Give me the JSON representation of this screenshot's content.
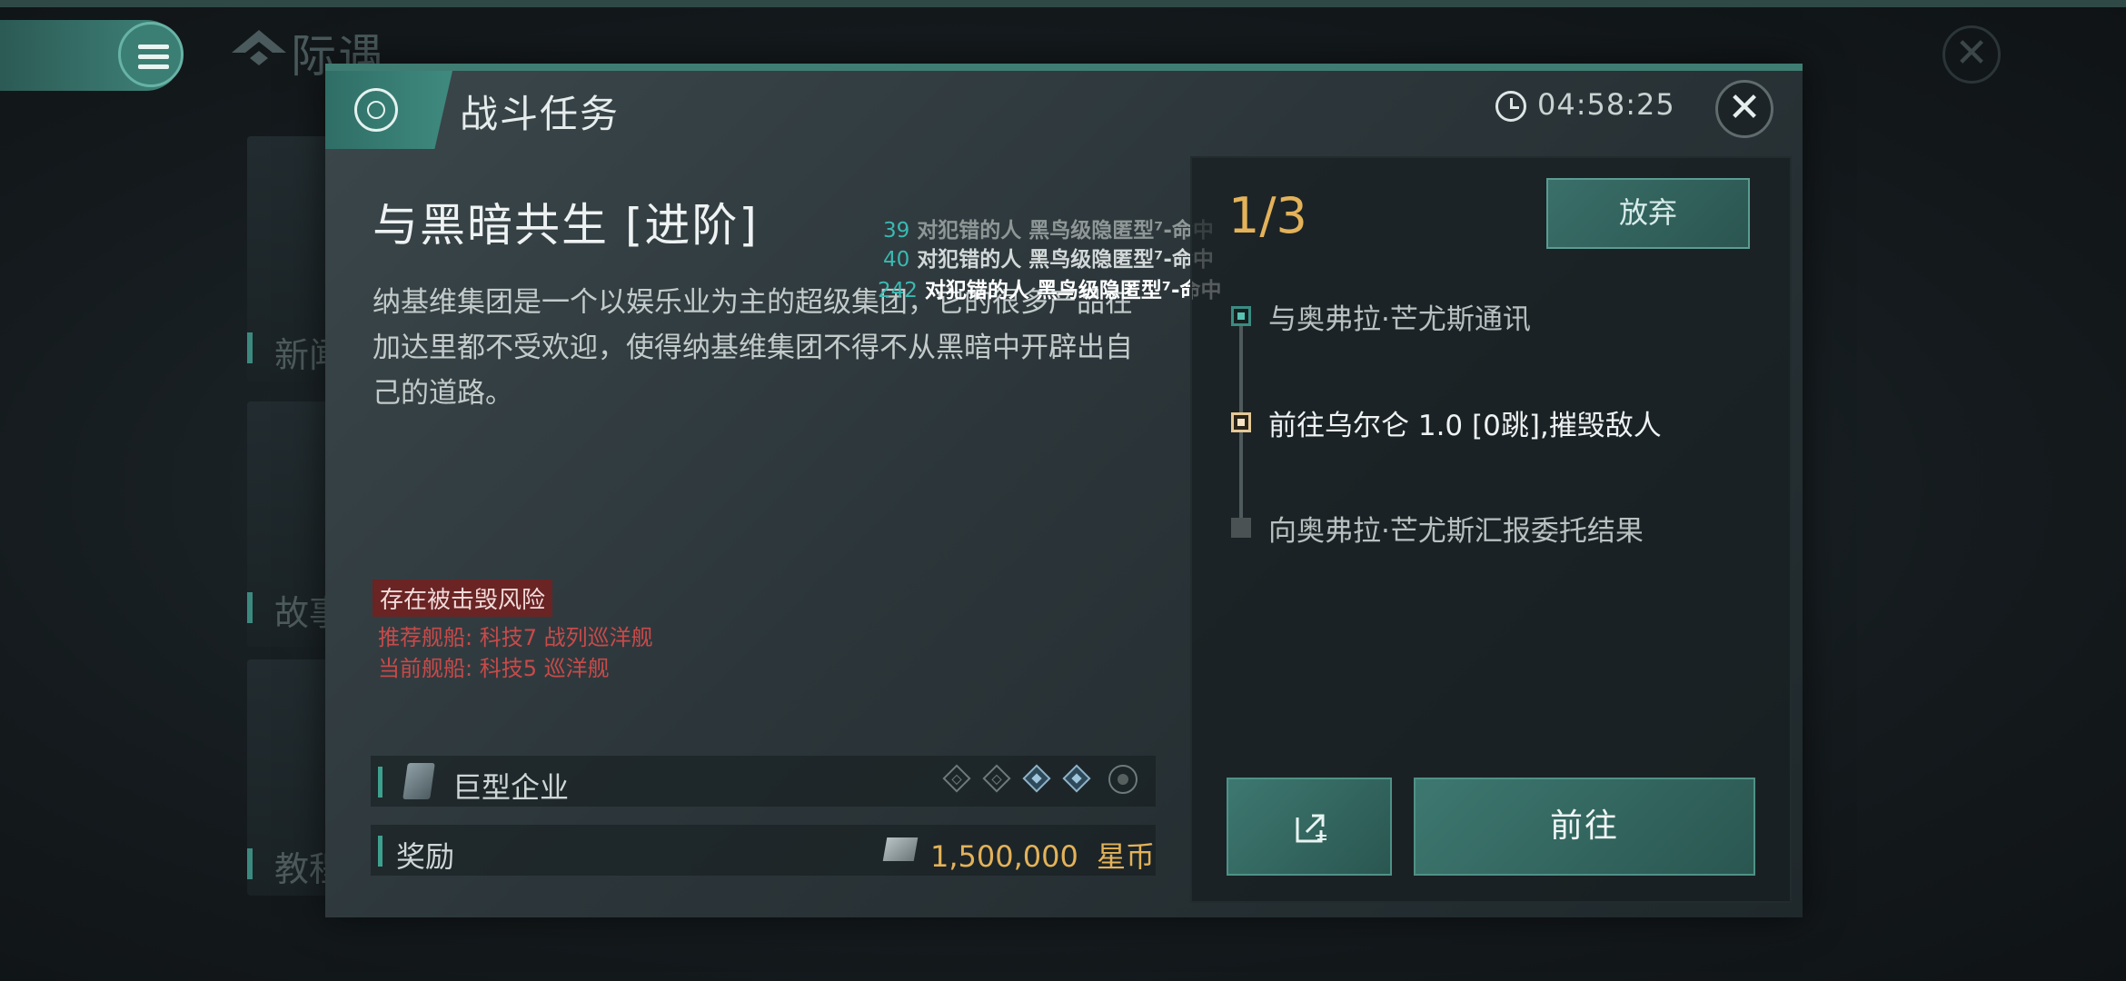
{
  "background": {
    "title": "际遇",
    "cards": [
      {
        "label": "新闻"
      },
      {
        "label": "故事"
      },
      {
        "label": "教程"
      }
    ]
  },
  "dialog": {
    "header_title": "战斗任务",
    "timer": "04:58:25",
    "close_symbol": "✕"
  },
  "mission": {
    "title": "与黑暗共生 [进阶]",
    "description": "纳基维集团是一个以娱乐业为主的超级集团，它的很多产品在加达里都不受欢迎，使得纳基维集团不得不从黑暗中开辟出自己的道路。",
    "risk_badge": "存在被击毁风险",
    "recommended_ship": "推荐舰船: 科技7 战列巡洋舰",
    "current_ship": "当前舰船: 科技5 巡洋舰",
    "faction_label": "巨型企业",
    "difficulty_max": 5,
    "difficulty_highlighted": [
      3,
      4
    ],
    "reward_label": "奖励",
    "reward_value": "1,500,000",
    "reward_unit": "星币"
  },
  "combat_log": [
    {
      "damage": "39",
      "text": "对犯错的人 黑鸟级隐匿型⁷-命中"
    },
    {
      "damage": "40",
      "text": "对犯错的人 黑鸟级隐匿型⁷-命中"
    },
    {
      "damage": "242",
      "text": "对犯错的人 黑鸟级隐匿型⁷-命中"
    }
  ],
  "objectives": {
    "progress": "1/3",
    "abandon_label": "放弃",
    "steps": [
      {
        "label": "与奥弗拉·芒尤斯通讯",
        "state": "done"
      },
      {
        "label": "前往乌尔仑 1.0 [0跳],摧毁敌人",
        "state": "active"
      },
      {
        "label": "向奥弗拉·芒尤斯汇报委托结果",
        "state": "todo"
      }
    ],
    "go_label": "前往"
  },
  "colors": {
    "accent": "#3f857b",
    "gold": "#e3b25a",
    "danger": "#c84a4a",
    "log_number": "#3ab9b2"
  },
  "icons": {
    "menu": "menu-icon",
    "header": "mission-target-icon",
    "timer": "clock-icon",
    "close": "close-icon",
    "share": "share-icon",
    "corp": "corporation-icon",
    "coin": "isk-coin-icon"
  }
}
